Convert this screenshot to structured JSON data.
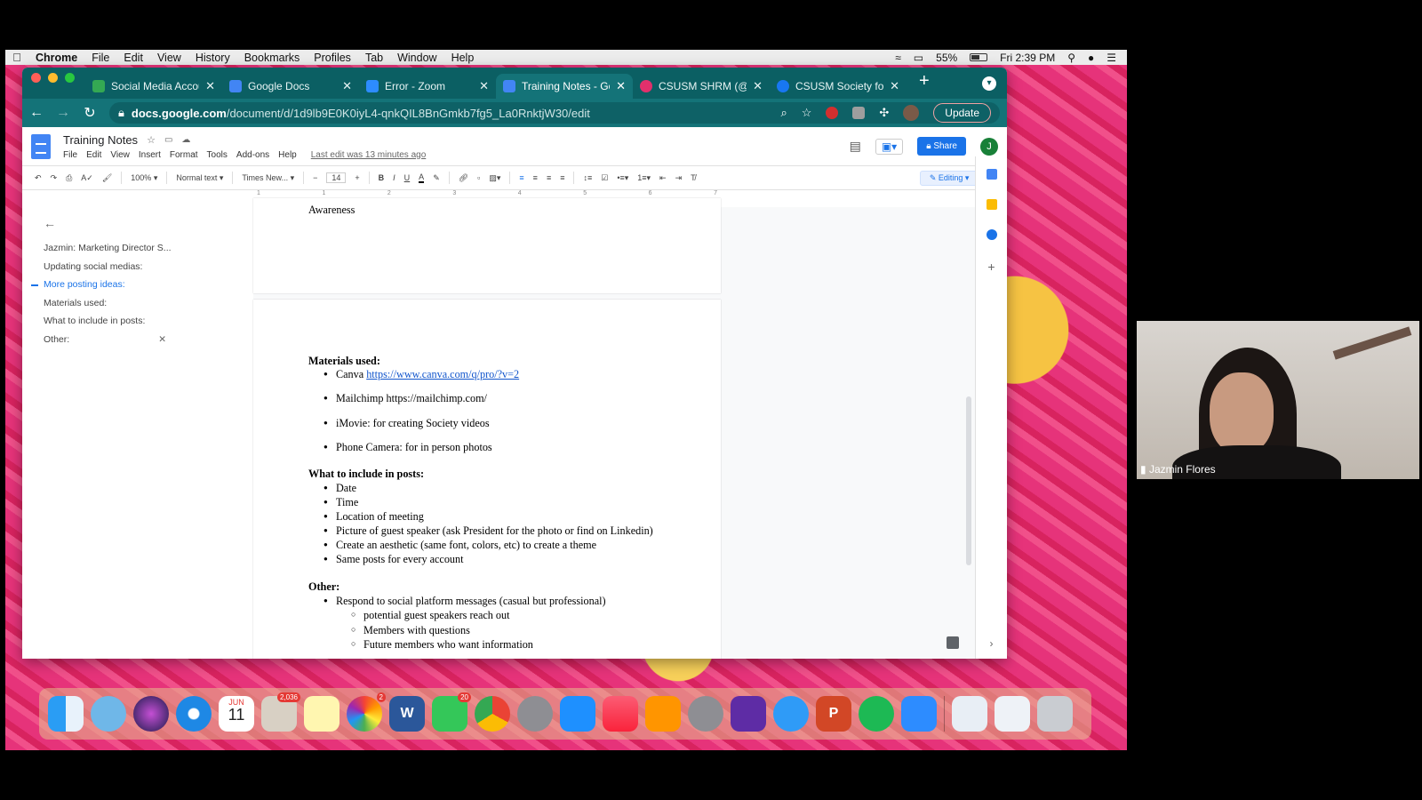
{
  "menubar": {
    "app": "Chrome",
    "items": [
      "File",
      "Edit",
      "View",
      "History",
      "Bookmarks",
      "Profiles",
      "Tab",
      "Window",
      "Help"
    ],
    "battery": "55%",
    "clock": "Fri 2:39 PM"
  },
  "tabs": [
    {
      "label": "Social Media Accoun",
      "color": "#34a853"
    },
    {
      "label": "Google Docs",
      "color": "#4285f4"
    },
    {
      "label": "Error - Zoom",
      "color": "#2d8cff"
    },
    {
      "label": "Training Notes - Goo",
      "color": "#4285f4"
    },
    {
      "label": "CSUSM SHRM (@csu",
      "color": "#e1306c"
    },
    {
      "label": "CSUSM Society for H",
      "color": "#1877f2"
    }
  ],
  "address": {
    "domain": "docs.google.com",
    "path": "/document/d/1d9lb9E0K0iyL4-qnkQIL8BnGmkb7fg5_La0RnktjW30/edit",
    "update_label": "Update"
  },
  "doc": {
    "title": "Training Notes",
    "menu": [
      "File",
      "Edit",
      "View",
      "Insert",
      "Format",
      "Tools",
      "Add-ons",
      "Help"
    ],
    "last_edit": "Last edit was 13 minutes ago",
    "share_label": "Share",
    "user_initial": "J"
  },
  "toolbar": {
    "zoom": "100%",
    "style": "Normal text",
    "font": "Times New...",
    "size": "14",
    "mode": "Editing"
  },
  "outline": {
    "items": [
      "Jazmin: Marketing Director S...",
      "Updating social medias:",
      "More posting ideas:",
      "Materials used:",
      "What to include in posts:",
      "Other:"
    ]
  },
  "content": {
    "prev_page_tail": "Awareness",
    "materials_heading": "Materials used:",
    "materials": {
      "canva_text": "Canva",
      "canva_link": "https://www.canva.com/q/pro/?v=2",
      "mailchimp": "Mailchimp https://mailchimp.com/",
      "imovie": "iMovie: for creating Society videos",
      "phone": "Phone Camera: for in person photos"
    },
    "include_heading": "What to include in posts:",
    "include": [
      "Date",
      "Time",
      "Location of meeting",
      "Picture of guest speaker (ask President for the photo or find on Linkedin)",
      "Create an aesthetic (same font, colors, etc) to create a theme",
      "Same posts for every account"
    ],
    "other_heading": "Other:",
    "other_item": "Respond to social platform messages (casual but professional)",
    "other_sub": [
      "potential guest speakers reach out",
      "Members with questions",
      "Future members who want information"
    ]
  },
  "dock_badges": {
    "photos": "2,036",
    "photos2": "2",
    "facetime": "20",
    "calendar_month": "JUN",
    "calendar_day": "11"
  },
  "video": {
    "name": "Jazmin Flores"
  }
}
